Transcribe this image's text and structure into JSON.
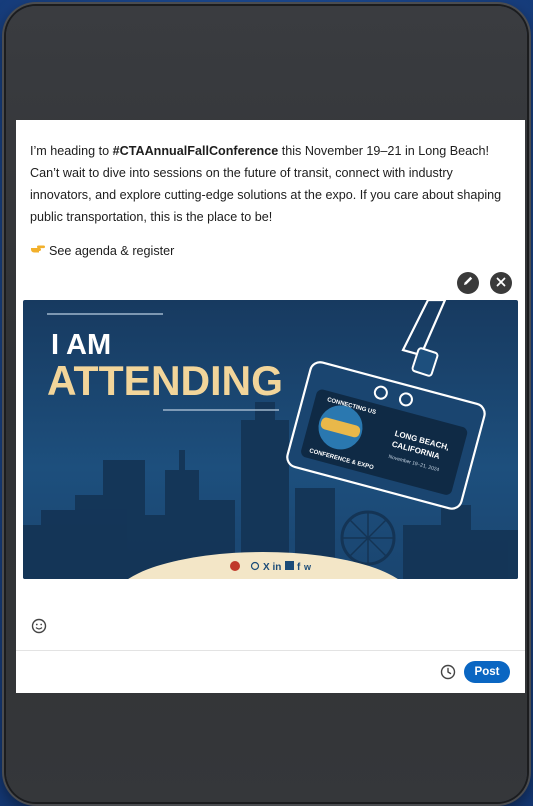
{
  "post": {
    "text_before_hashtag": "I’m heading to ",
    "hashtag": "#CTAAnnualFallConference",
    "text_after_hashtag": " this November 19–21 in Long Beach! Can’t wait to dive into sessions on the future of transit, connect with industry innovators, and explore cutting-edge solutions at the expo. If you care about shaping public transportation, this is the place to be!",
    "cta": "See agenda & register"
  },
  "media": {
    "headline_line1": "I AM",
    "headline_line2": "ATTENDING",
    "badge_top": "CONNECTING US",
    "badge_conf": "CONFERENCE & EXPO",
    "badge_city": "LONG BEACH,",
    "badge_state": "CALIFORNIA",
    "badge_dates": "November 19–21, 2024"
  },
  "composer": {
    "post_label": "Post"
  },
  "colors": {
    "accent": "#0a66c2",
    "banner_dark": "#12304f",
    "banner_mid": "#1b4b78",
    "headline_gold": "#f2d59a"
  },
  "icons": [
    "edit-icon",
    "close-icon",
    "emoji-icon",
    "clock-icon",
    "pointing-hand-icon"
  ]
}
